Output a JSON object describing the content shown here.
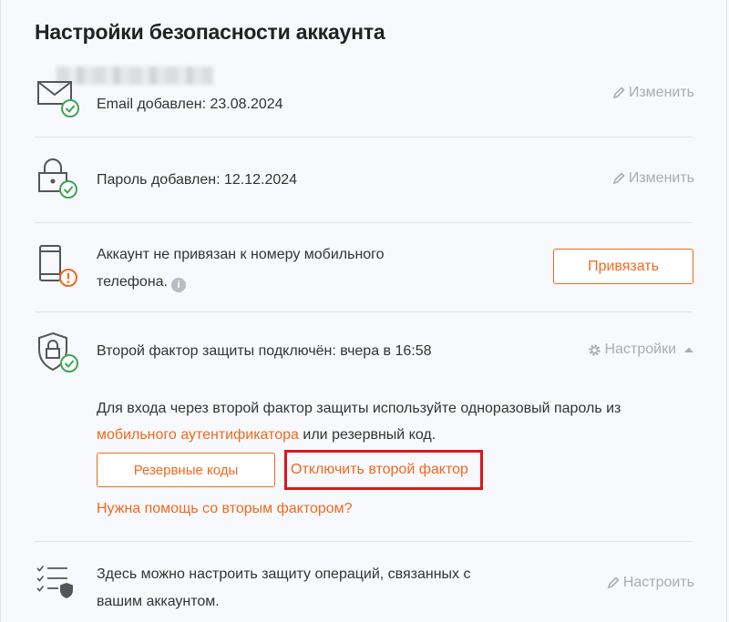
{
  "page": {
    "title": "Настройки безопасности аккаунта"
  },
  "email": {
    "status": "Email добавлен: 23.08.2024",
    "action": "Изменить"
  },
  "password": {
    "status": "Пароль добавлен: 12.12.2024",
    "action": "Изменить"
  },
  "phone": {
    "status_line1": "Аккаунт не привязан к номеру мобильного",
    "status_line2": "телефона.",
    "info_glyph": "i",
    "action": "Привязать"
  },
  "twofa": {
    "status": "Второй фактор защиты подключён: вчера в 16:58",
    "settings": "Настройки",
    "desc_part1": "Для входа через второй фактор защиты используйте одноразовый пароль из",
    "desc_link": "мобильного аутентификатора",
    "desc_part2": "или резервный код.",
    "backup_button": "Резервные коды",
    "disable_link": "Отключить второй фактор",
    "help_link": "Нужна помощь со вторым фактором?"
  },
  "operations": {
    "text_line1": "Здесь можно настроить защиту операций, связанных с",
    "text_line2": "вашим аккаунтом.",
    "action": "Настроить"
  },
  "colors": {
    "accent": "#ef6a1f",
    "success": "#3aa655",
    "warning": "#ef6a1f",
    "highlight": "#d9171e"
  }
}
